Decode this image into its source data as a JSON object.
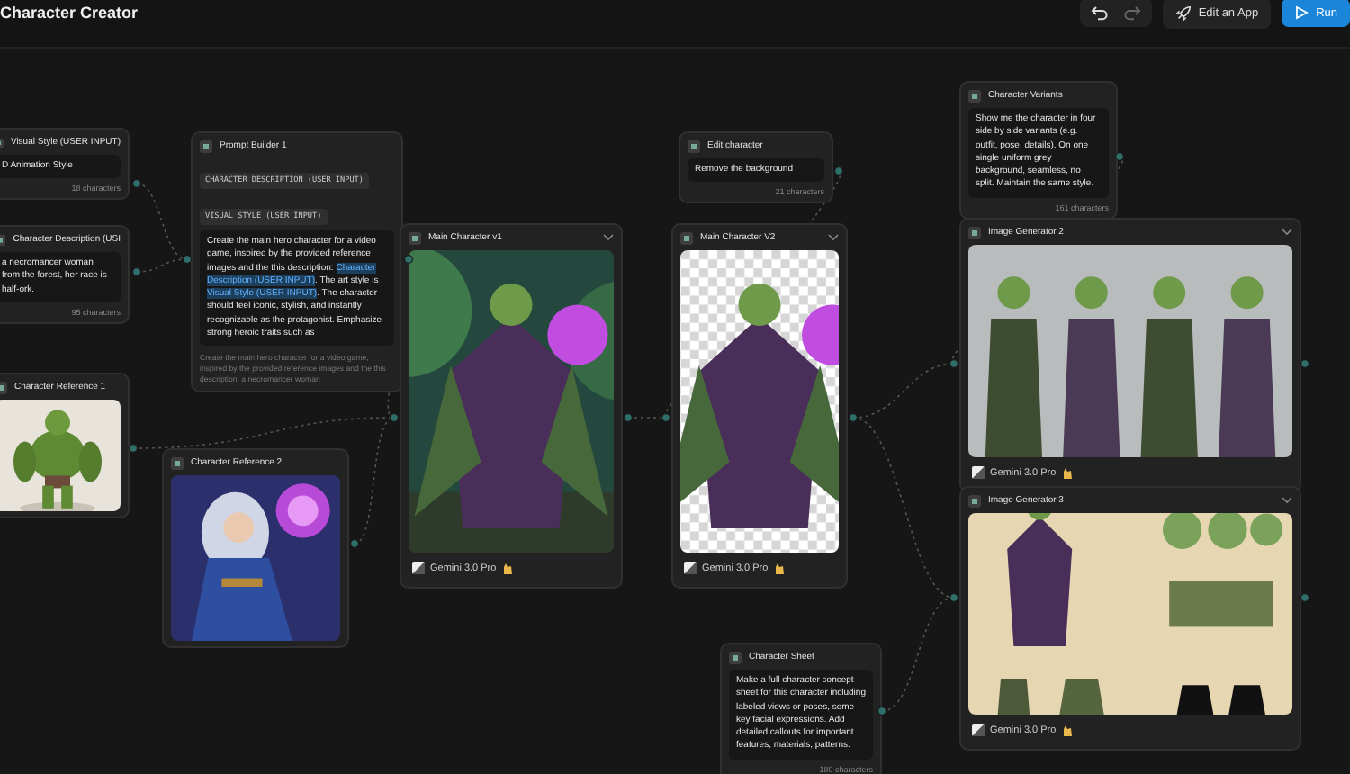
{
  "header": {
    "title": "Character Creator",
    "edit_button": "Edit an App",
    "run_button": "Run"
  },
  "nodes": [
    {
      "kind": "text-input",
      "title": "Visual Style (USER INPUT)",
      "value": "D Animation Style",
      "count": "18 characters"
    },
    {
      "kind": "text-input",
      "title": "Character Description (USI",
      "value": "a necromancer woman from the forest, her race is half-ork.",
      "count": "95 characters"
    },
    {
      "title": "Character Reference 1"
    },
    {
      "kind": "prompt",
      "title": "Prompt Builder 1",
      "tags": [
        "CHARACTER DESCRIPTION (USER INPUT)",
        "VISUAL STYLE (USER INPUT)"
      ],
      "segments": [
        {
          "kind": "text",
          "text": "Create the main hero character for a video game, inspired by the provided reference images and the this description: "
        },
        {
          "kind": "variable",
          "text": "Character Description (USER INPUT)"
        },
        {
          "kind": "text",
          "text": ". The art style is "
        },
        {
          "kind": "variable",
          "text": "Visual Style (USER INPUT)"
        },
        {
          "kind": "text",
          "text": ". The character should feel iconic, stylish, and instantly recognizable as the protagonist. Emphasize strong heroic traits such as"
        }
      ],
      "preview": "Create the main hero character for a video game, inspired by the provided reference images and the this description: a necromancer woman"
    },
    {
      "title": "Character Reference 2"
    },
    {
      "title": "Main Character v1",
      "model": "Gemini 3.0 Pro"
    },
    {
      "kind": "text-input",
      "title": "Edit character",
      "value": "Remove the background",
      "count": "21 characters"
    },
    {
      "title": "Main Character V2",
      "model": "Gemini 3.0 Pro"
    },
    {
      "kind": "text-input",
      "title": "Character Variants",
      "value": "Show me the character in four side by side variants (e.g. outfit, pose, details). On one single uniform grey background, seamless, no split. Maintain the same style.",
      "count": "161 characters"
    },
    {
      "title": "Image Generator 2",
      "model": "Gemini 3.0 Pro"
    },
    {
      "title": "Image Generator 3",
      "model": "Gemini 3.0 Pro"
    },
    {
      "kind": "text-input",
      "title": "Character Sheet",
      "value": "Make a full character concept sheet for this character including labeled views or poses, some key facial expressions. Add detailed callouts for important features, materials, patterns.",
      "count": "180 characters"
    }
  ]
}
